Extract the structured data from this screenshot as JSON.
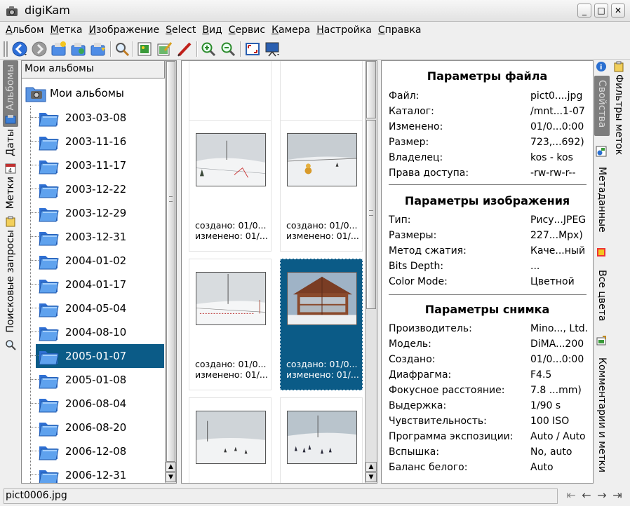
{
  "window": {
    "title": "digiKam",
    "controls": {
      "minimize": "_",
      "maximize": "□",
      "close": "✕"
    }
  },
  "menu": [
    "Альбом",
    "Метка",
    "Изображение",
    "Select",
    "Вид",
    "Сервис",
    "Камера",
    "Настройка",
    "Справка"
  ],
  "toolbar": {
    "buttons": [
      "back-icon",
      "forward-icon",
      "new-album-icon",
      "album-properties-icon",
      "album-import-icon",
      "search-icon",
      "view-image-icon",
      "edit-image-icon",
      "red-pen-icon",
      "zoom-in-icon",
      "zoom-out-icon",
      "fullscreen-icon",
      "slideshow-icon"
    ]
  },
  "left_tabs": [
    "Альбомы",
    "Даты",
    "Метки",
    "Поисковые запросы"
  ],
  "albums": {
    "header": "Мои альбомы",
    "root": "Мои альбомы",
    "items": [
      "2003-03-08",
      "2003-11-16",
      "2003-11-17",
      "2003-12-22",
      "2003-12-29",
      "2003-12-31",
      "2004-01-02",
      "2004-01-17",
      "2004-05-04",
      "2004-08-10",
      "2005-01-07",
      "2005-01-08",
      "2006-08-04",
      "2006-08-20",
      "2006-12-08",
      "2006-12-31"
    ],
    "selected": "2005-01-07"
  },
  "icon_view": {
    "cells": [
      {
        "created": "создано: 01/0...",
        "modified": "изменено: 01/...",
        "selected": false
      },
      {
        "created": "создано: 01/0...",
        "modified": "изменено: 01/...",
        "selected": false
      },
      {
        "created": "создано: 01/0...",
        "modified": "изменено: 01/...",
        "selected": false
      },
      {
        "created": "создано: 01/0...",
        "modified": "изменено: 01/...",
        "selected": false
      },
      {
        "created": "создано: 01/0...",
        "modified": "изменено: 01/...",
        "selected": false
      },
      {
        "created": "создано: 01/0...",
        "modified": "изменено: 01/...",
        "selected": true
      },
      {
        "created": "",
        "modified": "",
        "selected": false
      },
      {
        "created": "",
        "modified": "",
        "selected": false
      }
    ]
  },
  "properties": {
    "file": {
      "title": "Параметры файла",
      "rows": [
        {
          "k": "Файл:",
          "v": "pict0....jpg"
        },
        {
          "k": "Каталог:",
          "v": "/mnt...1-07"
        },
        {
          "k": "Изменено:",
          "v": "01/0...0:00"
        },
        {
          "k": "Размер:",
          "v": "723,...692)"
        },
        {
          "k": "Владелец:",
          "v": "kos - kos"
        },
        {
          "k": "Права доступа:",
          "v": "-rw-rw-r--"
        }
      ]
    },
    "image": {
      "title": "Параметры изображения",
      "rows": [
        {
          "k": "Тип:",
          "v": "Рису...JPEG"
        },
        {
          "k": "Размеры:",
          "v": "227...Mpx)"
        },
        {
          "k": "Метод сжатия:",
          "v": "Каче...ный"
        },
        {
          "k": "Bits Depth:",
          "v": "..."
        },
        {
          "k": "Color Mode:",
          "v": "Цветной"
        }
      ]
    },
    "photo": {
      "title": "Параметры снимка",
      "rows": [
        {
          "k": "Производитель:",
          "v": "Mino..., Ltd."
        },
        {
          "k": "Модель:",
          "v": "DiMA...200"
        },
        {
          "k": "Создано:",
          "v": "01/0...0:00"
        },
        {
          "k": "Диафрагма:",
          "v": "F4.5"
        },
        {
          "k": "Фокусное расстояние:",
          "v": "7.8 ...mm)"
        },
        {
          "k": "Выдержка:",
          "v": "1/90 s"
        },
        {
          "k": "Чувствительность:",
          "v": "100 ISO"
        },
        {
          "k": "Программа экспозиции:",
          "v": "Auto / Auto"
        },
        {
          "k": "Вспышка:",
          "v": "No, auto"
        },
        {
          "k": "Баланс белого:",
          "v": "Auto"
        }
      ]
    }
  },
  "right_tabs": {
    "sidebar": [
      "Свойства",
      "Метаданные",
      "Все цвета",
      "Комментарии и метки"
    ],
    "outer": [
      "Фильтры меток"
    ]
  },
  "status": {
    "text": "pict0006.jpg",
    "nav": [
      "first-icon",
      "prev-icon",
      "next-icon",
      "last-icon"
    ]
  },
  "colors": {
    "selection": "#0b5b87",
    "window_bg": "#efefef"
  }
}
